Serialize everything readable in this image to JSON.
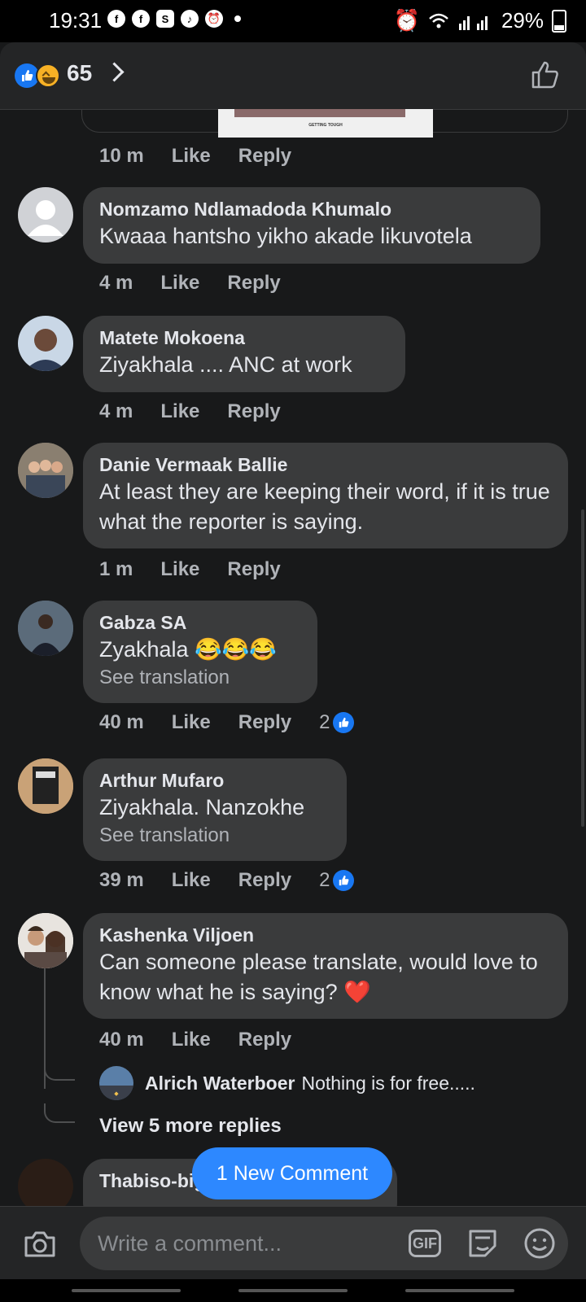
{
  "status_bar": {
    "time": "19:31",
    "battery": "29%",
    "notif_icons": [
      "facebook-icon",
      "facebook-icon",
      "s-icon",
      "tiktok-icon",
      "alarm-icon"
    ]
  },
  "header": {
    "reaction_count": "65"
  },
  "image_caption": "GETTING TOUGH",
  "top_meta": {
    "time": "10 m",
    "like": "Like",
    "reply": "Reply"
  },
  "comments": [
    {
      "author": "Nomzamo Ndlamadoda Khumalo",
      "text": "Kwaaa hantsho yikho akade likuvotela",
      "time": "4 m",
      "like": "Like",
      "reply": "Reply"
    },
    {
      "author": "Matete Mokoena",
      "text": "Ziyakhala .... ANC at work",
      "time": "4 m",
      "like": "Like",
      "reply": "Reply"
    },
    {
      "author": "Danie Vermaak Ballie",
      "text": "At least they are keeping their word, if it is true what the reporter is saying.",
      "time": "1 m",
      "like": "Like",
      "reply": "Reply"
    },
    {
      "author": "Gabza SA",
      "text": "Zyakhala 😂😂😂",
      "translation": "See translation",
      "time": "40 m",
      "like": "Like",
      "reply": "Reply",
      "reactions": "2"
    },
    {
      "author": "Arthur Mufaro",
      "text": "Ziyakhala. Nanzokhe",
      "translation": "See translation",
      "time": "39 m",
      "like": "Like",
      "reply": "Reply",
      "reactions": "2"
    },
    {
      "author": "Kashenka Viljoen",
      "text": "Can someone please translate, would love to know what he is saying? ❤️",
      "time": "40 m",
      "like": "Like",
      "reply": "Reply"
    }
  ],
  "reply_preview": {
    "author": "Alrich Waterboer",
    "text": "Nothing is for free....."
  },
  "view_more": "View 5 more replies",
  "partial_author": "Thabiso-big Ngwako Malesa",
  "new_comment_pill": "1 New Comment",
  "composer": {
    "placeholder": "Write a comment...",
    "gif_label": "GIF"
  },
  "colors": {
    "background": "#18191a",
    "bubble": "#3a3b3c",
    "accent": "#2d88ff",
    "like_blue": "#1877f2"
  }
}
